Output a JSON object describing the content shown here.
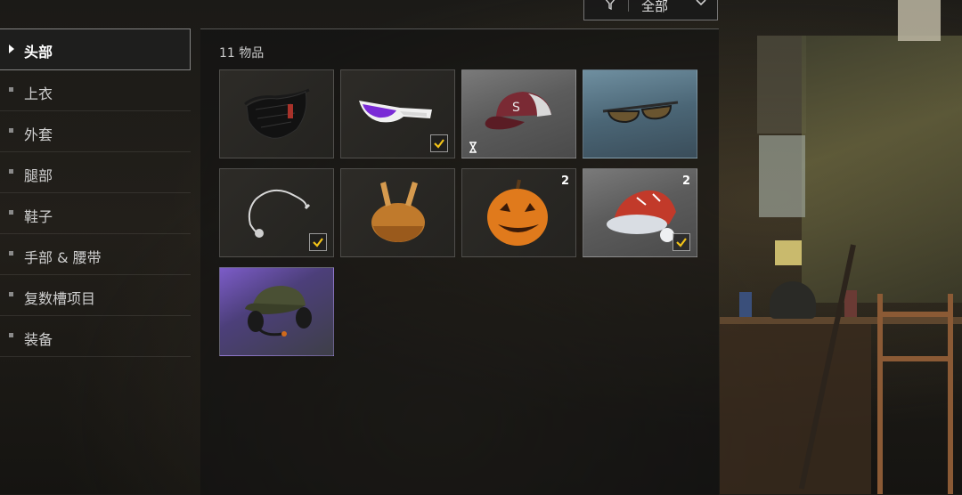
{
  "filter": {
    "value": "全部"
  },
  "sidebar": {
    "items": [
      {
        "label": "头部",
        "active": true
      },
      {
        "label": "上衣"
      },
      {
        "label": "外套"
      },
      {
        "label": "腿部"
      },
      {
        "label": "鞋子"
      },
      {
        "label": "手部 & 腰带"
      },
      {
        "label": "复数槽项目"
      },
      {
        "label": "装备"
      }
    ]
  },
  "inventory": {
    "count_label": "11 物品",
    "items": [
      {
        "icon": "face-mask-icon",
        "equipped": false
      },
      {
        "icon": "sunglasses-icon",
        "equipped": true
      },
      {
        "icon": "baseball-cap-icon",
        "timed": true
      },
      {
        "icon": "aviator-sunglasses-icon"
      },
      {
        "icon": "headset-mic-icon",
        "equipped": true
      },
      {
        "icon": "turkey-hat-icon"
      },
      {
        "icon": "pumpkin-head-icon",
        "quantity": "2"
      },
      {
        "icon": "santa-hat-icon",
        "quantity": "2",
        "equipped": true
      },
      {
        "icon": "cap-headset-icon"
      }
    ]
  },
  "colors": {
    "check": "#f2c318",
    "accent_border": "#ffffff"
  }
}
